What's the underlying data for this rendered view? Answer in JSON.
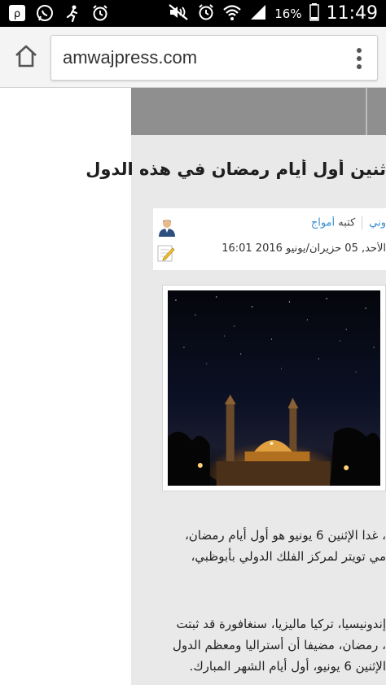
{
  "status_bar": {
    "battery": "16%",
    "time": "11:49",
    "left_icons": [
      "app-icon",
      "whatsapp-icon",
      "running-person-icon",
      "alarm-icon"
    ],
    "right_icons": [
      "mute-icon",
      "alarm-icon",
      "wifi-icon",
      "signal-icon",
      "battery-icon"
    ]
  },
  "browser": {
    "url": "amwajpress.com",
    "home_icon": "home-icon",
    "menu_icon": "overflow-menu-icon"
  },
  "article": {
    "title": "ثنين أول أيام رمضان في هذه الدول",
    "category_fragment": "وني",
    "written_by": "كتبه",
    "author": "أمواج",
    "date": "الأحد, 05 حزيران/يونيو 2016 16:01",
    "image_alt_icon": "mosque-night-image",
    "paragraph1": [
      "، غدا الإثنين 6 يونيو هو أول أيام رمضان،",
      "مي تويتر لمركز الفلك الدولي بأبوظبي،"
    ],
    "paragraph2": [
      "إندونيسيا، تركيا ماليزيا، سنغافورة قد ثبتت",
      "، رمضان، مضيفا أن أستراليا ومعظم الدول",
      "الإثنين 6 يونيو، أول أيام الشهر المبارك."
    ]
  },
  "colors": {
    "status_bg": "#000000",
    "toolbar_bg": "#f4f4f4",
    "content_bg": "#e9e9e9",
    "hero_strip": "#8f8f8f",
    "link": "#3a8fd0"
  }
}
